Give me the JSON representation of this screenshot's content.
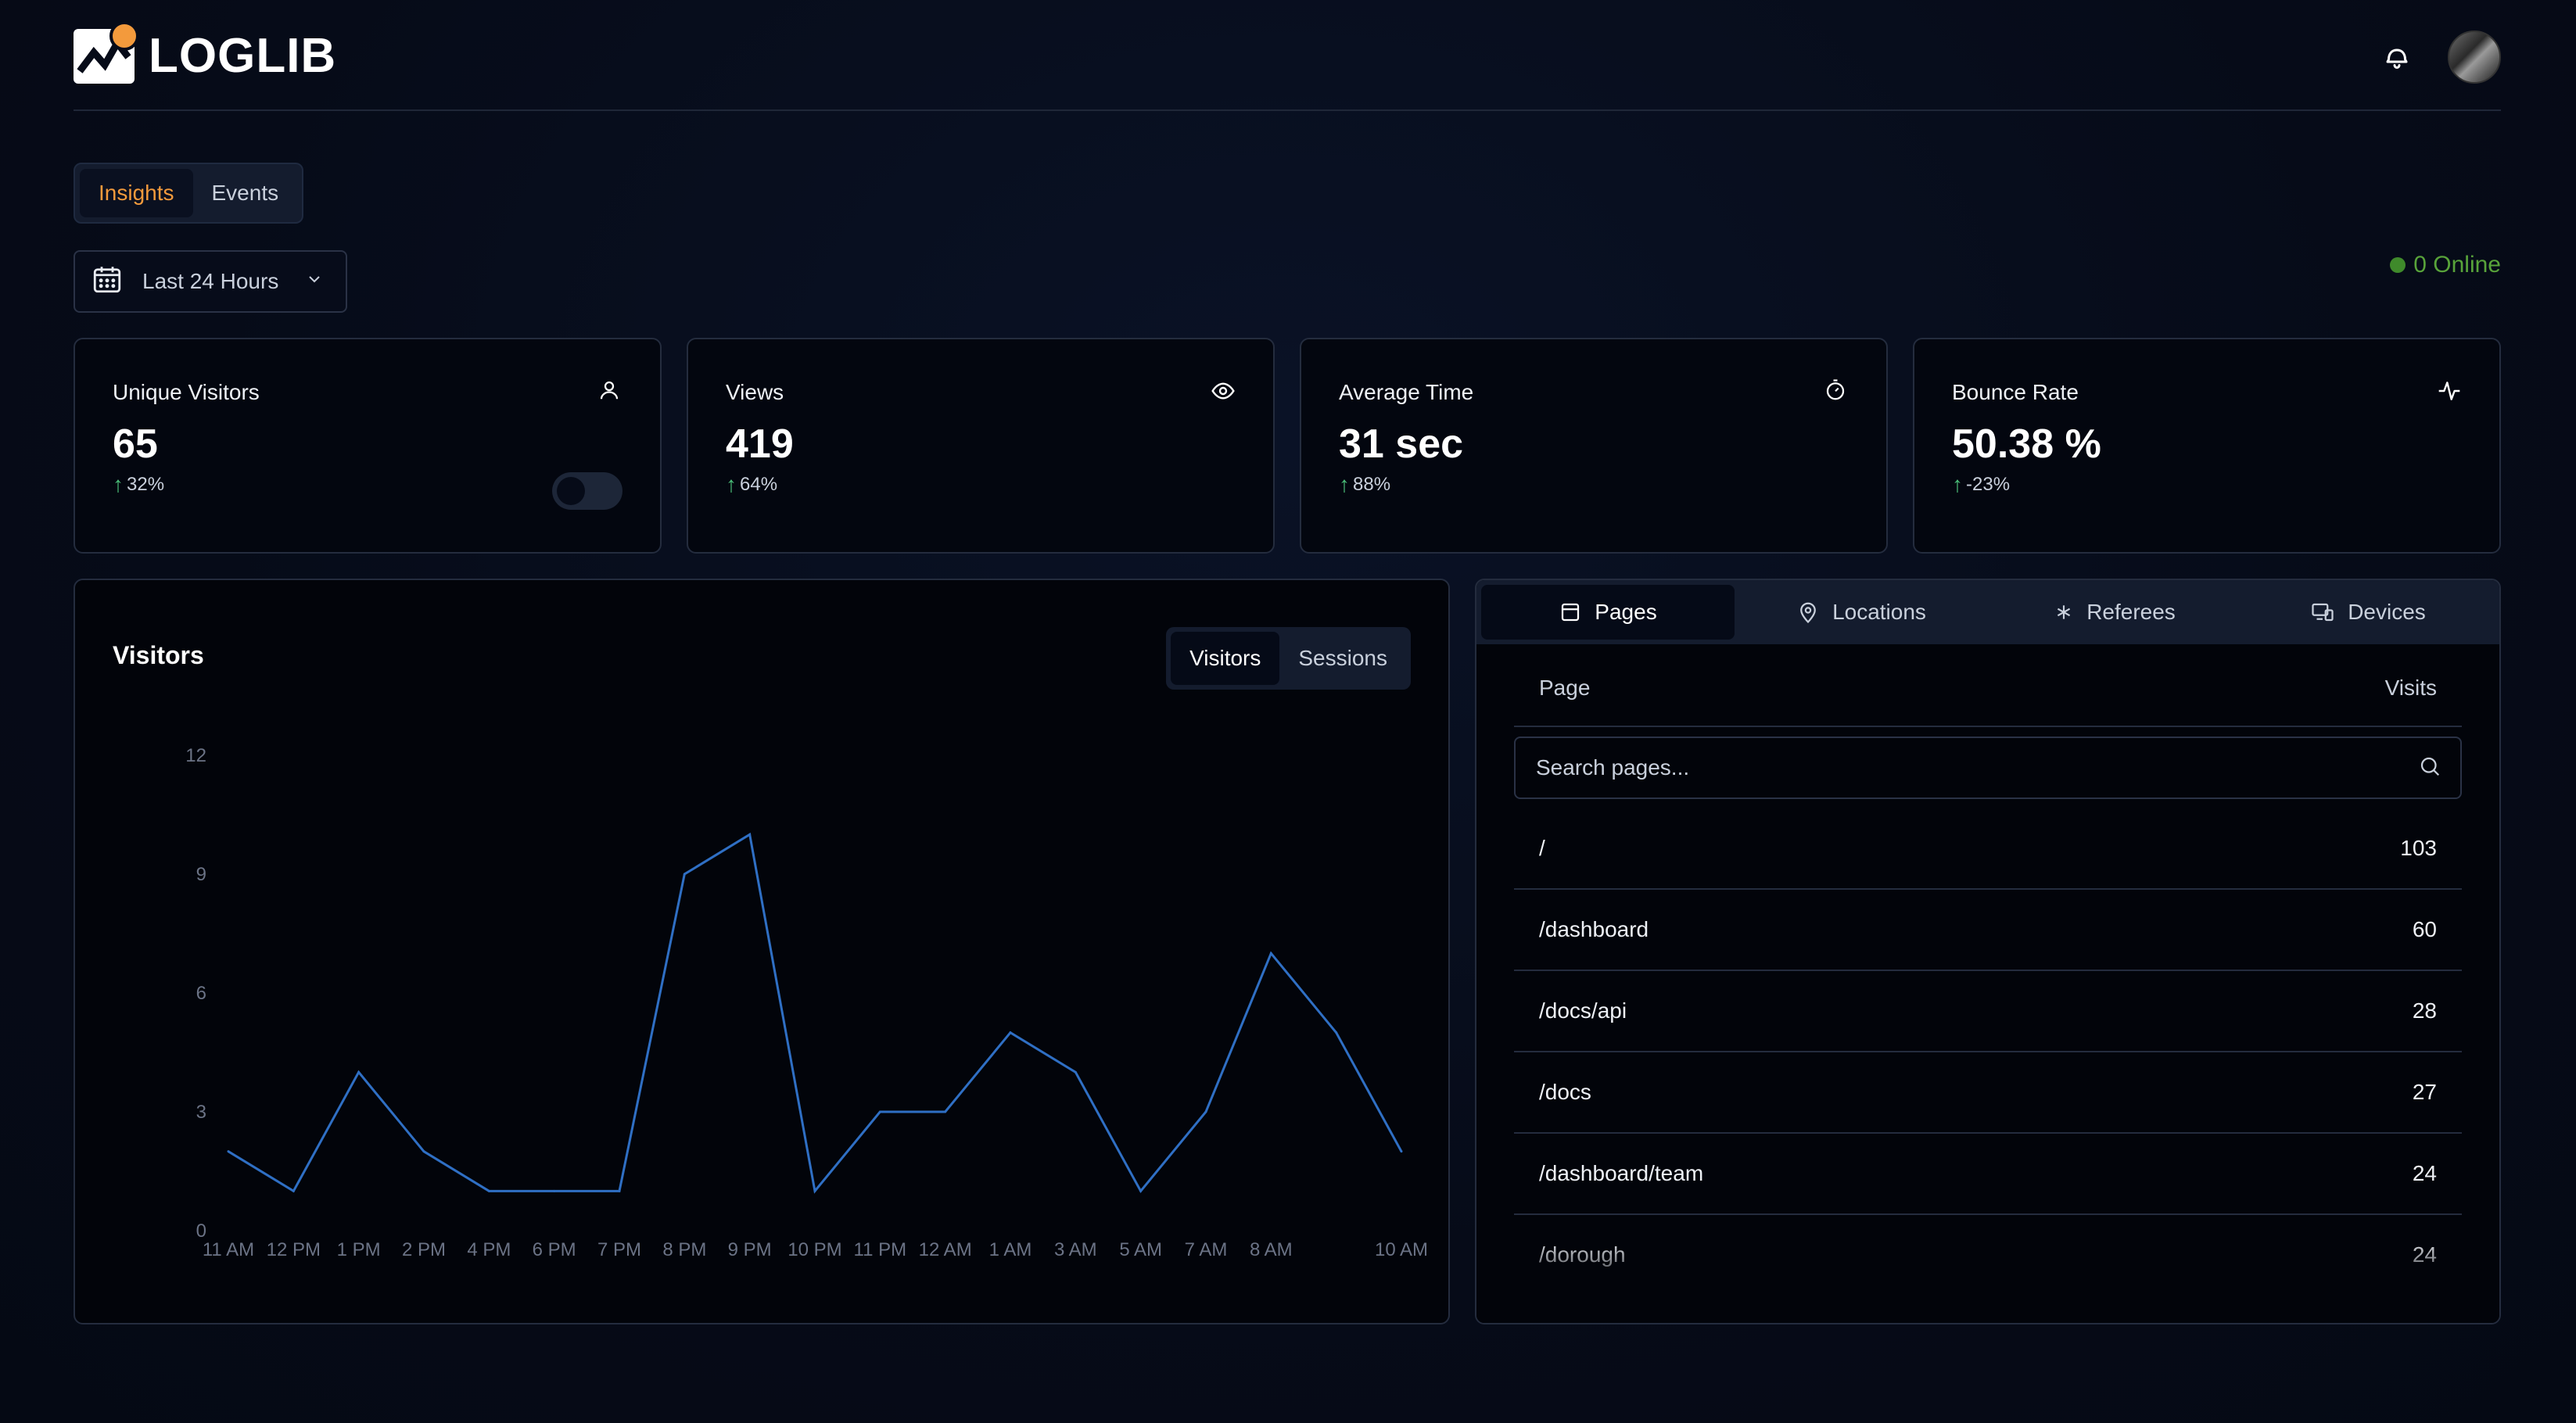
{
  "header": {
    "logo_text": "LOGLIB",
    "icons": [
      "bell-icon",
      "avatar"
    ]
  },
  "tabs": [
    {
      "label": "Insights",
      "active": true
    },
    {
      "label": "Events",
      "active": false
    }
  ],
  "date_picker": {
    "label": "Last 24 Hours",
    "icon": "calendar-icon"
  },
  "online": {
    "label": "0 Online",
    "color": "#58a33a"
  },
  "stats": [
    {
      "title": "Unique Visitors",
      "value": "65",
      "change": "32%",
      "icon": "user-icon",
      "has_toggle": true
    },
    {
      "title": "Views",
      "value": "419",
      "change": "64%",
      "icon": "eye-icon"
    },
    {
      "title": "Average Time",
      "value": "31 sec",
      "change": "88%",
      "icon": "timer-icon"
    },
    {
      "title": "Bounce Rate",
      "value": "50.38 %",
      "change": "-23%",
      "icon": "activity-icon"
    }
  ],
  "chart_card": {
    "title": "Visitors",
    "toggle": [
      {
        "label": "Visitors",
        "active": true
      },
      {
        "label": "Sessions",
        "active": false
      }
    ]
  },
  "chart_data": {
    "type": "line",
    "x": [
      "11 AM",
      "12 PM",
      "1 PM",
      "2 PM",
      "4 PM",
      "6 PM",
      "7 PM",
      "8 PM",
      "9 PM",
      "10 PM",
      "11 PM",
      "12 AM",
      "1 AM",
      "3 AM",
      "5 AM",
      "7 AM",
      "8 AM",
      "",
      "10 AM"
    ],
    "series": [
      {
        "values": [
          2,
          1,
          4,
          2,
          1,
          1,
          1,
          9,
          10,
          1,
          3,
          3,
          5,
          4,
          1,
          3,
          7,
          5,
          2
        ],
        "color": "#2f6fc4"
      }
    ],
    "y_ticks": [
      0,
      3,
      6,
      9,
      12
    ],
    "ylim": [
      0,
      12
    ],
    "grid": false
  },
  "panel": {
    "tabs": [
      {
        "label": "Pages",
        "icon": "page-icon",
        "active": true
      },
      {
        "label": "Locations",
        "icon": "map-pin-icon",
        "active": false
      },
      {
        "label": "Referees",
        "icon": "asterisk-icon",
        "active": false
      },
      {
        "label": "Devices",
        "icon": "devices-icon",
        "active": false
      }
    ],
    "col_page": "Page",
    "col_visits": "Visits",
    "search_placeholder": "Search pages...",
    "rows": [
      {
        "page": "/",
        "visits": "103"
      },
      {
        "page": "/dashboard",
        "visits": "60"
      },
      {
        "page": "/docs/api",
        "visits": "28"
      },
      {
        "page": "/docs",
        "visits": "27"
      },
      {
        "page": "/dashboard/team",
        "visits": "24"
      },
      {
        "page": "/dorough",
        "visits": "24"
      }
    ]
  }
}
